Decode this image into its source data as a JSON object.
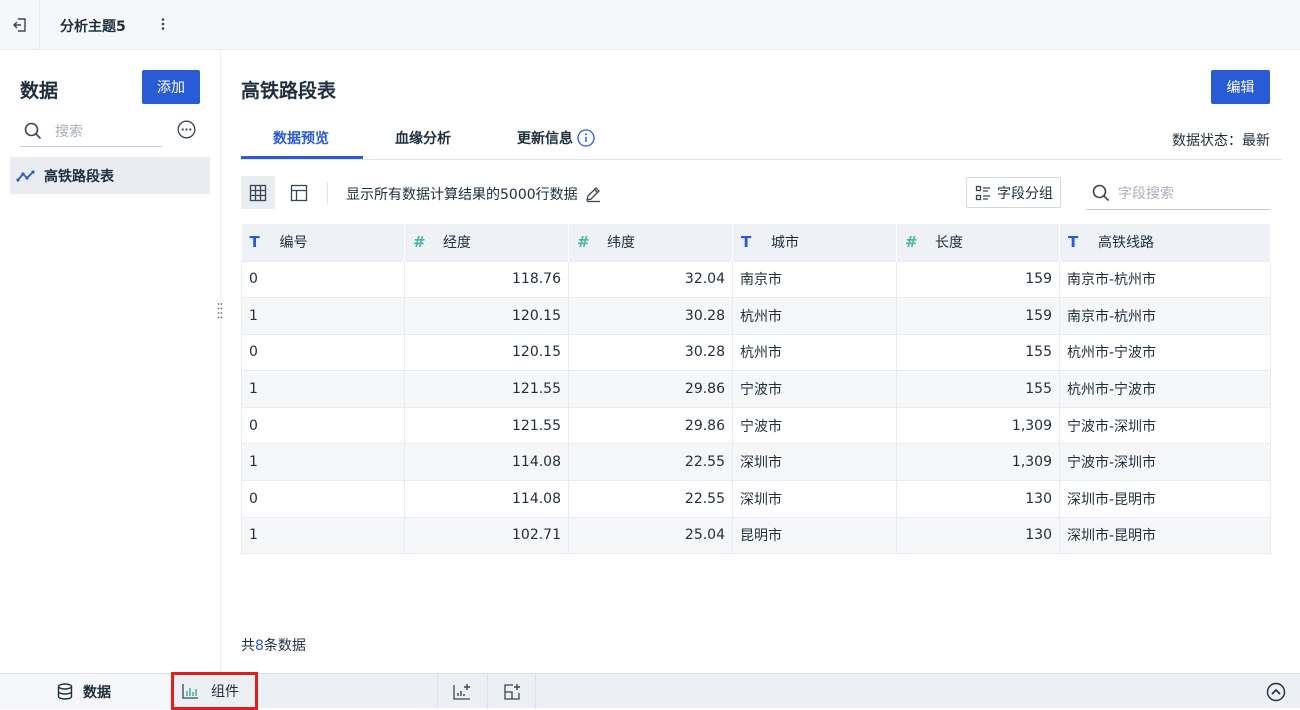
{
  "topbar": {
    "title": "分析主题5",
    "icons": [
      "exit-icon",
      "kebab-icon"
    ]
  },
  "left_panel": {
    "title": "数据",
    "add_label": "添加",
    "search_placeholder": "搜索",
    "dataset": {
      "label": "高铁路段表",
      "icon": "line-chart-icon"
    }
  },
  "main": {
    "title": "高铁路段表",
    "edit_label": "编辑",
    "tabs": [
      {
        "label": "数据预览",
        "active": true
      },
      {
        "label": "血缘分析",
        "active": false
      },
      {
        "label": "更新信息",
        "active": false
      }
    ],
    "status": "数据状态：最新",
    "toolbar": {
      "description": "显示所有数据计算结果的5000行数据",
      "group_label": "字段分组",
      "field_search_placeholder": "字段搜索"
    },
    "table": {
      "columns": [
        {
          "label": "编号",
          "type": "text",
          "type_icon": "T"
        },
        {
          "label": "经度",
          "type": "number",
          "type_icon": "#"
        },
        {
          "label": "纬度",
          "type": "number",
          "type_icon": "#"
        },
        {
          "label": "城市",
          "type": "text",
          "type_icon": "T"
        },
        {
          "label": "长度",
          "type": "number",
          "type_icon": "#"
        },
        {
          "label": "高铁线路",
          "type": "text",
          "type_icon": "T"
        }
      ],
      "rows": [
        [
          "0",
          "118.76",
          "32.04",
          "南京市",
          "159",
          "南京市-杭州市"
        ],
        [
          "1",
          "120.15",
          "30.28",
          "杭州市",
          "159",
          "南京市-杭州市"
        ],
        [
          "0",
          "120.15",
          "30.28",
          "杭州市",
          "155",
          "杭州市-宁波市"
        ],
        [
          "1",
          "121.55",
          "29.86",
          "宁波市",
          "155",
          "杭州市-宁波市"
        ],
        [
          "0",
          "121.55",
          "29.86",
          "宁波市",
          "1,309",
          "宁波市-深圳市"
        ],
        [
          "1",
          "114.08",
          "22.55",
          "深圳市",
          "1,309",
          "宁波市-深圳市"
        ],
        [
          "0",
          "114.08",
          "22.55",
          "深圳市",
          "130",
          "深圳市-昆明市"
        ],
        [
          "1",
          "102.71",
          "25.04",
          "昆明市",
          "130",
          "深圳市-昆明市"
        ]
      ]
    },
    "footer": {
      "prefix": "共",
      "count": "8",
      "suffix": "条数据"
    }
  },
  "bottombar": {
    "data_label": "数据",
    "component_label": "组件",
    "highlight_color": "#e0201a"
  },
  "colors": {
    "accent": "#2a5bd7",
    "number_icon": "#4db3a5"
  }
}
